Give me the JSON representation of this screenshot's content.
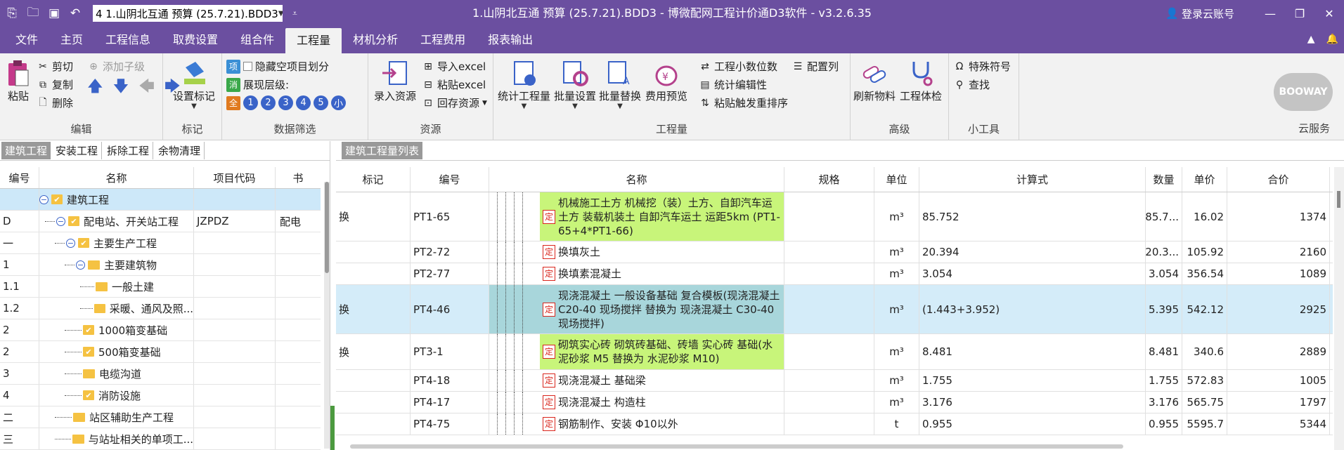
{
  "titlebar": {
    "doc": "4 1.山阴北互通 预算 (25.7.21).BDD3",
    "title": "1.山阴北互通 预算 (25.7.21).BDD3 - 博微配网工程计价通D3软件 - v3.2.6.35",
    "login": "登录云账号"
  },
  "menu": [
    "文件",
    "主页",
    "工程信息",
    "取费设置",
    "组合件",
    "工程量",
    "材机分析",
    "工程费用",
    "报表输出"
  ],
  "ribbon": {
    "edit": {
      "paste": "粘贴",
      "cut": "剪切",
      "copy": "复制",
      "delete": "删除",
      "addchild": "添加子级",
      "label": "编辑"
    },
    "mark": {
      "setmark": "设置标记",
      "label": "标记"
    },
    "filter": {
      "hide": "隐藏空项目划分",
      "level": "展现层级:",
      "i1": "项",
      "i2": "消",
      "i3": "全",
      "lv": [
        "1",
        "2",
        "3",
        "4",
        "5",
        "小"
      ],
      "label": "数据筛选"
    },
    "resource": {
      "entry": "录入资源",
      "importx": "导入excel",
      "pastex": "粘贴excel",
      "backres": "回存资源",
      "label": "资源"
    },
    "qty": {
      "stat": "统计工程量",
      "batchset": "批量设置",
      "batchrep": "批量替换",
      "feeprev": "费用预览",
      "digits": "工程小数位数",
      "stateedit": "统计编辑性",
      "resort": "粘贴触发重排序",
      "cfgcol": "配置列",
      "label": "工程量"
    },
    "adv": {
      "refresh": "刷新物料",
      "check": "工程体检",
      "label": "高级"
    },
    "tools": {
      "special": "特殊符号",
      "find": "查找",
      "label": "小工具"
    },
    "cloud": {
      "logo": "BOOWAY",
      "label": "云服务"
    }
  },
  "leftTabs": [
    "建筑工程",
    "安装工程",
    "拆除工程",
    "余物清理"
  ],
  "tree": {
    "headers": [
      "编号",
      "名称",
      "项目代码",
      "书"
    ],
    "rows": [
      {
        "no": "",
        "name": "建筑工程",
        "code": "",
        "extra": ""
      },
      {
        "no": "D",
        "name": "配电站、开关站工程",
        "code": "JZPDZ",
        "extra": "配电"
      },
      {
        "no": "一",
        "name": "主要生产工程",
        "code": "",
        "extra": ""
      },
      {
        "no": "1",
        "name": "主要建筑物",
        "code": "",
        "extra": ""
      },
      {
        "no": "1.1",
        "name": "一般土建",
        "code": "",
        "extra": ""
      },
      {
        "no": "1.2",
        "name": "采暖、通风及照...",
        "code": "",
        "extra": ""
      },
      {
        "no": "2",
        "name": "1000箱变基础",
        "code": "",
        "extra": ""
      },
      {
        "no": "2",
        "name": "500箱变基础",
        "code": "",
        "extra": ""
      },
      {
        "no": "3",
        "name": "电缆沟道",
        "code": "",
        "extra": ""
      },
      {
        "no": "4",
        "name": "消防设施",
        "code": "",
        "extra": ""
      },
      {
        "no": "二",
        "name": "站区辅助生产工程",
        "code": "",
        "extra": ""
      },
      {
        "no": "三",
        "name": "与站址相关的单项工...",
        "code": "",
        "extra": ""
      }
    ]
  },
  "rightTab": "建筑工程量列表",
  "grid": {
    "headers": [
      "标记",
      "编号",
      "名称",
      "规格",
      "单位",
      "计算式",
      "数量",
      "单价",
      "合价"
    ],
    "ding": "定",
    "rows": [
      {
        "mark": "换",
        "code": "PT1-65",
        "name": "机械施工土方 机械挖（装）土方、自卸汽车运土方 装载机装土 自卸汽车运土 运距5km (PT1-65+4*PT1-66)",
        "spec": "",
        "unit": "m³",
        "formula": "85.752",
        "qty": "85.7...",
        "price": "16.02",
        "total": "1374"
      },
      {
        "mark": "",
        "code": "PT2-72",
        "name": "换填灰土",
        "spec": "",
        "unit": "m³",
        "formula": "20.394",
        "qty": "20.3...",
        "price": "105.92",
        "total": "2160"
      },
      {
        "mark": "",
        "code": "PT2-77",
        "name": "换填素混凝土",
        "spec": "",
        "unit": "m³",
        "formula": "3.054",
        "qty": "3.054",
        "price": "356.54",
        "total": "1089"
      },
      {
        "mark": "换",
        "code": "PT4-46",
        "name": "现浇混凝土 一般设备基础 复合模板(现浇混凝土C20-40 现场搅拌 替换为 现浇混凝土 C30-40 现场搅拌)",
        "spec": "",
        "unit": "m³",
        "formula": "(1.443+3.952)",
        "qty": "5.395",
        "price": "542.12",
        "total": "2925"
      },
      {
        "mark": "换",
        "code": "PT3-1",
        "name": "砌筑实心砖 砌筑砖基础、砖墙 实心砖 基础(水泥砂浆 M5 替换为 水泥砂浆 M10)",
        "spec": "",
        "unit": "m³",
        "formula": "8.481",
        "qty": "8.481",
        "price": "340.6",
        "total": "2889"
      },
      {
        "mark": "",
        "code": "PT4-18",
        "name": "现浇混凝土 基础梁",
        "spec": "",
        "unit": "m³",
        "formula": "1.755",
        "qty": "1.755",
        "price": "572.83",
        "total": "1005"
      },
      {
        "mark": "",
        "code": "PT4-17",
        "name": "现浇混凝土 构造柱",
        "spec": "",
        "unit": "m³",
        "formula": "3.176",
        "qty": "3.176",
        "price": "565.75",
        "total": "1797"
      },
      {
        "mark": "",
        "code": "PT4-75",
        "name": "钢筋制作、安装 Φ10以外",
        "spec": "",
        "unit": "t",
        "formula": "0.955",
        "qty": "0.955",
        "price": "5595.7",
        "total": "5344"
      }
    ]
  },
  "colors": {
    "title": "#6b4fa0",
    "green": "#c8f57a",
    "teal": "#a8d6db",
    "selected": "#cde8f9"
  }
}
